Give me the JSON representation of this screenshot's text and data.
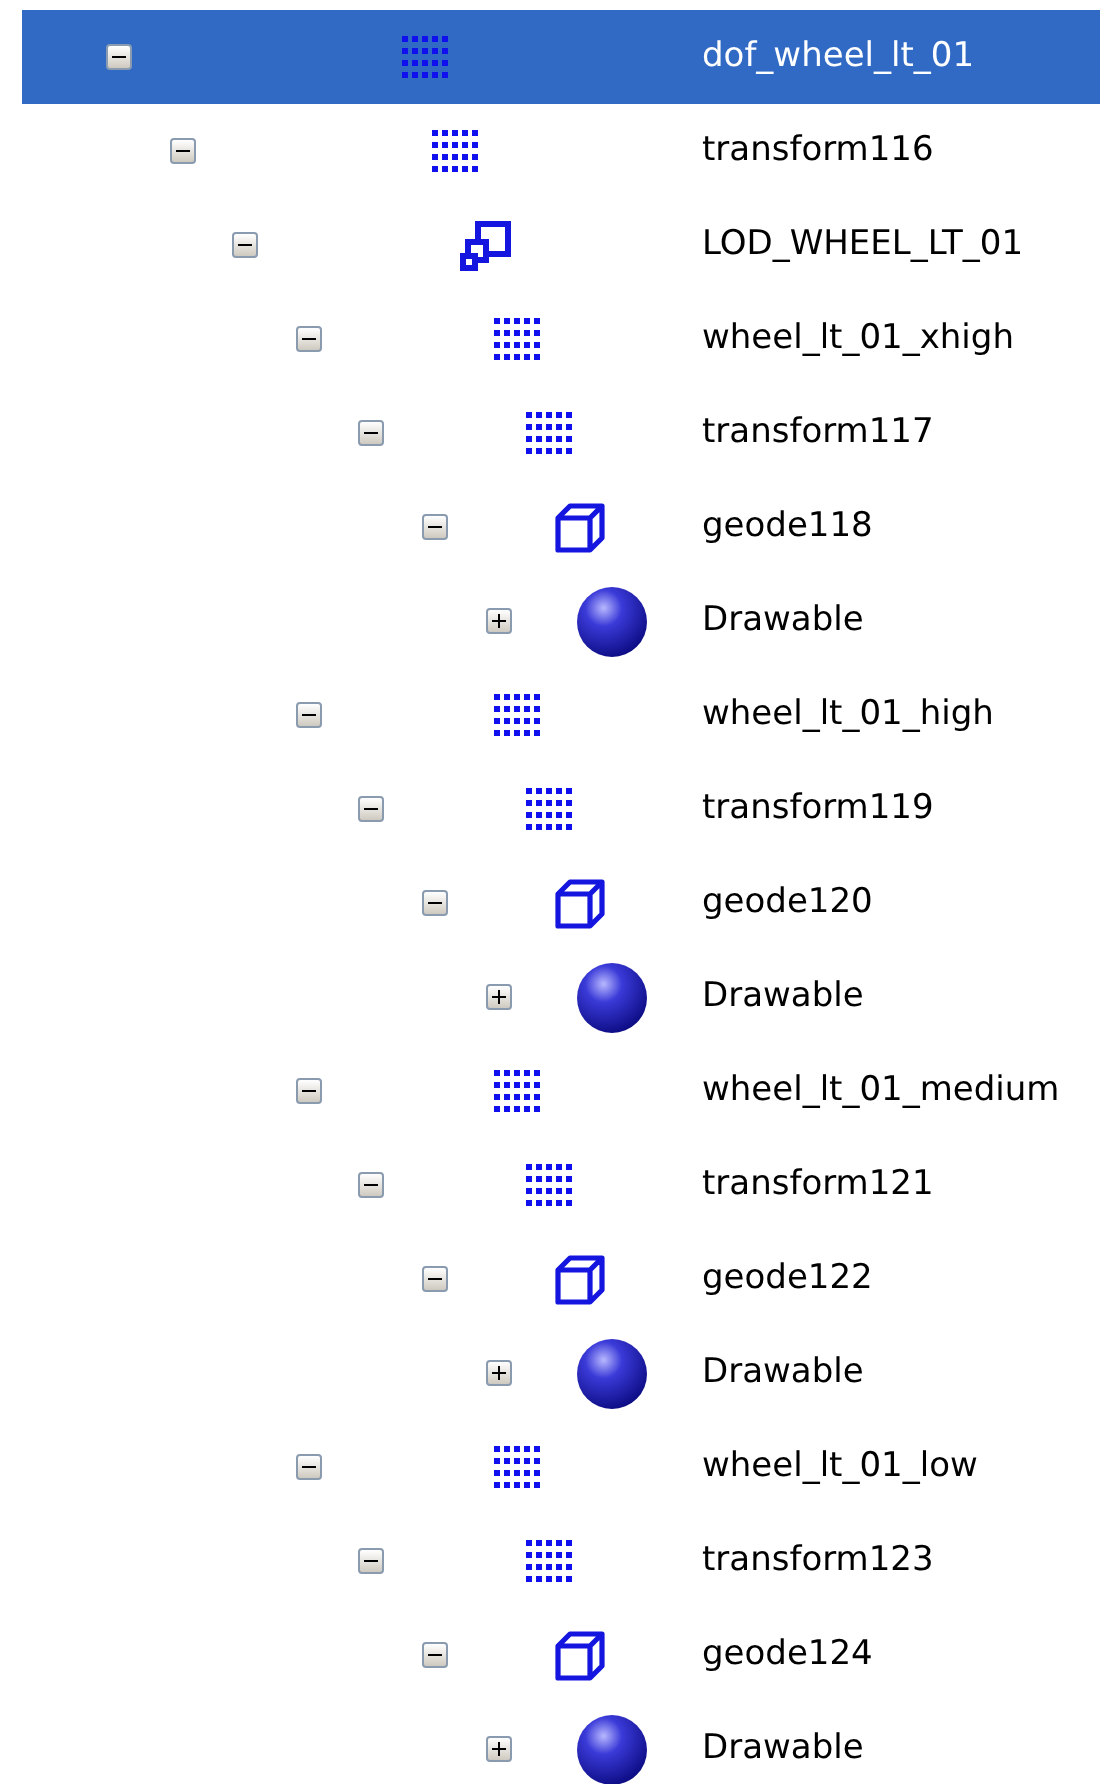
{
  "tree": [
    {
      "label": "dof_wheel_lt_01",
      "kind": "group",
      "expanded": true,
      "selected": true,
      "children": [
        {
          "label": "transform116",
          "kind": "group",
          "expanded": true,
          "selected": false,
          "children": [
            {
              "label": "LOD_WHEEL_LT_01",
              "kind": "lod",
              "expanded": true,
              "selected": false,
              "children": [
                {
                  "label": "wheel_lt_01_xhigh",
                  "kind": "group",
                  "expanded": true,
                  "selected": false,
                  "children": [
                    {
                      "label": "transform117",
                      "kind": "group",
                      "expanded": true,
                      "selected": false,
                      "children": [
                        {
                          "label": "geode118",
                          "kind": "geode",
                          "expanded": true,
                          "selected": false,
                          "children": [
                            {
                              "label": "Drawable",
                              "kind": "drawable",
                              "expanded": false,
                              "selected": false
                            }
                          ]
                        }
                      ]
                    }
                  ]
                },
                {
                  "label": "wheel_lt_01_high",
                  "kind": "group",
                  "expanded": true,
                  "selected": false,
                  "children": [
                    {
                      "label": "transform119",
                      "kind": "group",
                      "expanded": true,
                      "selected": false,
                      "children": [
                        {
                          "label": "geode120",
                          "kind": "geode",
                          "expanded": true,
                          "selected": false,
                          "children": [
                            {
                              "label": "Drawable",
                              "kind": "drawable",
                              "expanded": false,
                              "selected": false
                            }
                          ]
                        }
                      ]
                    }
                  ]
                },
                {
                  "label": "wheel_lt_01_medium",
                  "kind": "group",
                  "expanded": true,
                  "selected": false,
                  "children": [
                    {
                      "label": "transform121",
                      "kind": "group",
                      "expanded": true,
                      "selected": false,
                      "children": [
                        {
                          "label": "geode122",
                          "kind": "geode",
                          "expanded": true,
                          "selected": false,
                          "children": [
                            {
                              "label": "Drawable",
                              "kind": "drawable",
                              "expanded": false,
                              "selected": false
                            }
                          ]
                        }
                      ]
                    }
                  ]
                },
                {
                  "label": "wheel_lt_01_low",
                  "kind": "group",
                  "expanded": true,
                  "selected": false,
                  "children": [
                    {
                      "label": "transform123",
                      "kind": "group",
                      "expanded": true,
                      "selected": false,
                      "children": [
                        {
                          "label": "geode124",
                          "kind": "geode",
                          "expanded": true,
                          "selected": false,
                          "children": [
                            {
                              "label": "Drawable",
                              "kind": "drawable",
                              "expanded": false,
                              "selected": false
                            }
                          ]
                        }
                      ]
                    }
                  ]
                }
              ]
            }
          ]
        }
      ]
    }
  ]
}
